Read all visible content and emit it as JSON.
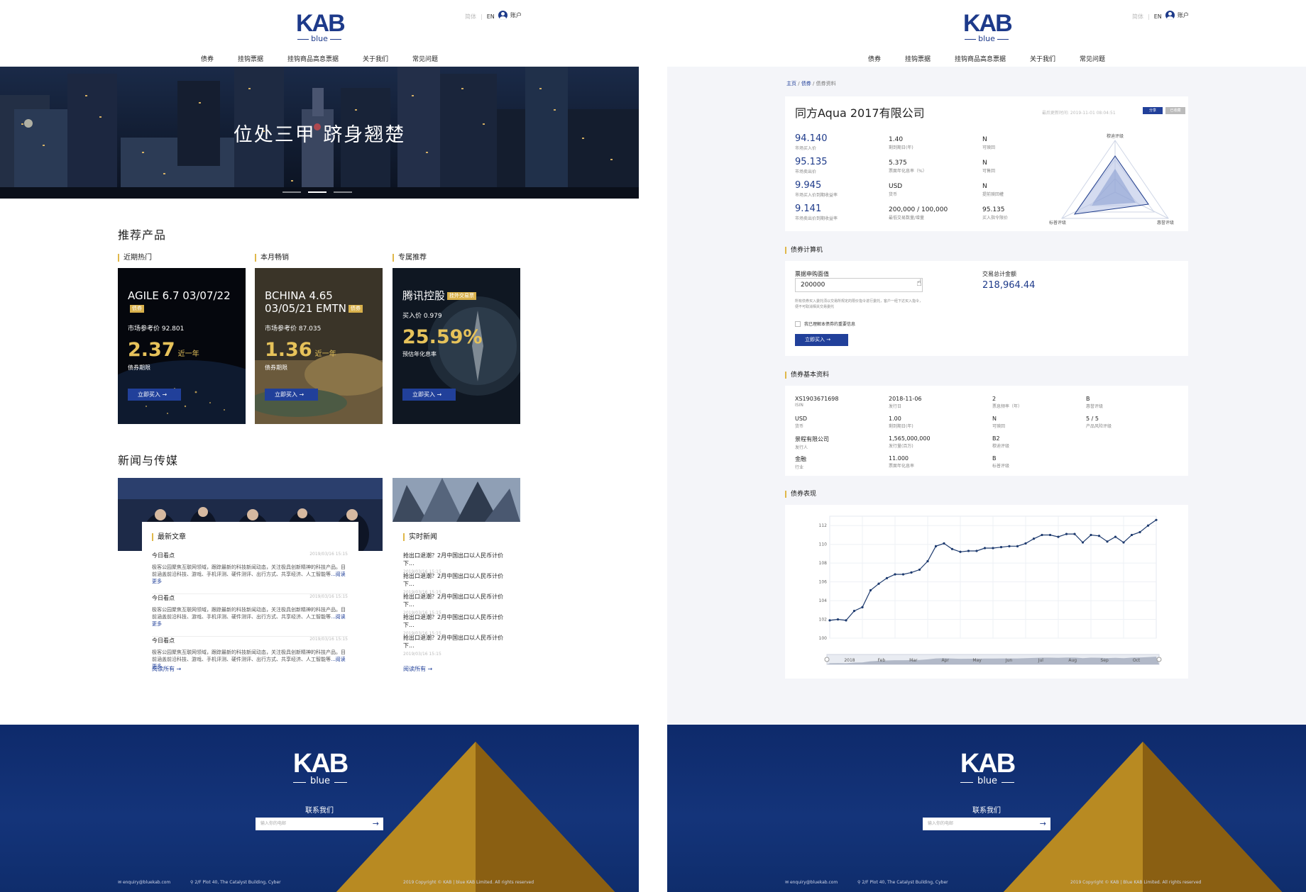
{
  "brand": {
    "logo_main": "KAB",
    "logo_sub": "blue"
  },
  "header": {
    "lang_zh": "简体",
    "lang_en": "EN",
    "account": "账户",
    "nav": [
      "债券",
      "挂钩票据",
      "挂钩商品高息票据",
      "关于我们",
      "常见问题"
    ]
  },
  "home": {
    "hero_title": "位处三甲  跻身翘楚",
    "recommended_title": "推荐产品",
    "cards": [
      {
        "category": "近期热门",
        "name": "AGILE 6.7 03/07/22",
        "tag": "债券",
        "ref": "市场参考价 92.801",
        "big": "2.37",
        "big_unit": "近一年",
        "big_label": "债券期限",
        "button": "立即买入"
      },
      {
        "category": "本月畅销",
        "name": "BCHINA 4.65 03/05/21 EMTN",
        "tag": "债券",
        "ref": "市场参考价 87.035",
        "big": "1.36",
        "big_unit": "近一年",
        "big_label": "债券期限",
        "button": "立即买入"
      },
      {
        "category": "专属推荐",
        "name": "腾讯控股",
        "tag": "挂外交易票",
        "ref": "买入价 0.979",
        "big": "25.59%",
        "big_unit": "",
        "big_label": "预估年化息率",
        "button": "立即买入"
      }
    ],
    "news_title": "新闻与传媒",
    "latest_title": "最新文章",
    "articles": [
      {
        "title": "今日看点",
        "date": "2019/03/16 15:15",
        "body": "极客公园聚焦互联网领域，跟踪最新的科技新闻动态，关注极具创新精神的科技产品。目前涵盖前沿科技、游戏、手机评测、硬件测评、出行方式、共享经济、人工智能等",
        "more": "...阅读更多"
      },
      {
        "title": "今日看点",
        "date": "2019/03/16 15:15",
        "body": "极客公园聚焦互联网领域，跟踪最新的科技新闻动态，关注极具创新精神的科技产品。目前涵盖前沿科技、游戏、手机评测、硬件测评、出行方式、共享经济、人工智能等",
        "more": "...阅读更多"
      },
      {
        "title": "今日看点",
        "date": "2019/03/16 15:15",
        "body": "极客公园聚焦互联网领域，跟踪最新的科技新闻动态，关注极具创新精神的科技产品。目前涵盖前沿科技、游戏、手机评测、硬件测评、出行方式、共享经济、人工智能等",
        "more": "...阅读更多"
      }
    ],
    "realtime_title": "实时新闻",
    "realtime": [
      {
        "title": "抢出口退潮？2月中国出口以人民币计价下...",
        "date": "2019/03/16 15:15"
      },
      {
        "title": "抢出口退潮？2月中国出口以人民币计价下...",
        "date": "2019/03/16 15:15"
      },
      {
        "title": "抢出口退潮？2月中国出口以人民币计价下...",
        "date": "2019/03/16 15:15"
      },
      {
        "title": "抢出口退潮？2月中国出口以人民币计价下...",
        "date": "2019/03/16 15:15"
      },
      {
        "title": "抢出口退潮？2月中国出口以人民币计价下...",
        "date": "2019/03/16 15:15"
      }
    ],
    "read_all": "阅读所有"
  },
  "footer": {
    "contact": "联系我们",
    "email_placeholder": "输入你的电邮",
    "email": "enquiry@bluekab.com",
    "address": "2/F Plot 40, The Catalyst Building, Cyber",
    "copyright_left": "2019 Copyright © KAB | blue KAB Limited. All rights reserved",
    "copyright_right": "2019 Copyright © KAB | Blue KAB Limited. All rights reserved"
  },
  "detail": {
    "breadcrumb": [
      "主页",
      "债券",
      "债券资料"
    ],
    "bond_name": "同方Aqua 2017有限公司",
    "updated": "最后更新时间: 2019-11-01 08:04:51",
    "share": "分享",
    "added": "已收藏",
    "metrics": [
      {
        "value": "94.140",
        "label": "市场买入价"
      },
      {
        "value": "95.135",
        "label": "市场卖出价"
      },
      {
        "value": "9.945",
        "label": "市场买入价到期收益率"
      },
      {
        "value": "9.141",
        "label": "市场卖出价到期收益率"
      }
    ],
    "metrics2": [
      {
        "value": "1.40",
        "label": "剩到期日(年)"
      },
      {
        "value": "5.375",
        "label": "票面年化息率（%）"
      },
      {
        "value": "USD",
        "label": "货币"
      },
      {
        "value": "200,000 / 100,000",
        "label": "最低交易数量/增量"
      }
    ],
    "metrics3": [
      {
        "value": "N",
        "label": "可赎回"
      },
      {
        "value": "N",
        "label": "可售回"
      },
      {
        "value": "N",
        "label": "提前赎回權"
      },
      {
        "value": "95.135",
        "label": "买入指令限价"
      }
    ],
    "radar_labels": [
      "穆迪评级",
      "标普评级",
      "惠誉评级"
    ],
    "calc_title": "债券计算机",
    "calc_face_label": "票据申购面值",
    "calc_face_value": "200000",
    "calc_total_label": "交易总计金额",
    "calc_total": "218,964.44",
    "calc_note": "所有债券买入委托须以交易所规定的限价指令进行委托，客户一经下达买入指令，便不可取消相关交易委托",
    "calc_agree": "我已理解本债券的重要信息",
    "calc_buy": "立即买入",
    "info_title": "债券基本资料",
    "info": [
      {
        "value": "XS1903671698",
        "label": "ISIN"
      },
      {
        "value": "2018-11-06",
        "label": "发行日"
      },
      {
        "value": "2",
        "label": "票息频率（年）"
      },
      {
        "value": "B",
        "label": "惠誉评级"
      },
      {
        "value": "USD",
        "label": "货币"
      },
      {
        "value": "1.00",
        "label": "剩到期日(年)"
      },
      {
        "value": "N",
        "label": "可赎回"
      },
      {
        "value": "5 / 5",
        "label": "产品风险评级"
      },
      {
        "value": "景程有限公司",
        "label": "发行人"
      },
      {
        "value": "1,565,000,000",
        "label": "发行量(百万)"
      },
      {
        "value": "B2",
        "label": "穆迪评级"
      },
      {
        "value": "",
        "label": ""
      },
      {
        "value": "金融",
        "label": "行业"
      },
      {
        "value": "11.000",
        "label": "票面年化息率"
      },
      {
        "value": "B",
        "label": "标普评级"
      },
      {
        "value": "",
        "label": ""
      }
    ],
    "perf_title": "债券表现"
  },
  "chart_data": {
    "type": "line",
    "y_ticks": [
      "112",
      "110",
      "108",
      "106",
      "104",
      "102",
      "100"
    ],
    "ylim": [
      100,
      113
    ],
    "x_ticks": [
      "2018",
      "Feb",
      "Mar",
      "Apr",
      "May",
      "Jun",
      "Jul",
      "Aug",
      "Sep",
      "Oct"
    ],
    "grid": true,
    "series": [
      {
        "values": [
          101.9,
          102.0,
          101.9,
          102.9,
          103.3,
          105.1,
          105.8,
          106.4,
          106.8,
          106.8,
          107.0,
          107.3,
          108.2,
          109.8,
          110.1,
          109.5,
          109.2,
          109.3,
          109.3,
          109.6,
          109.6,
          109.7,
          109.8,
          109.8,
          110.1,
          110.6,
          111.0,
          111.0,
          110.8,
          111.1,
          111.1,
          110.2,
          111.0,
          110.9,
          110.3,
          110.8,
          110.2,
          111.0,
          111.3,
          112.0,
          112.6
        ]
      }
    ],
    "color": "#1d3a6e"
  }
}
